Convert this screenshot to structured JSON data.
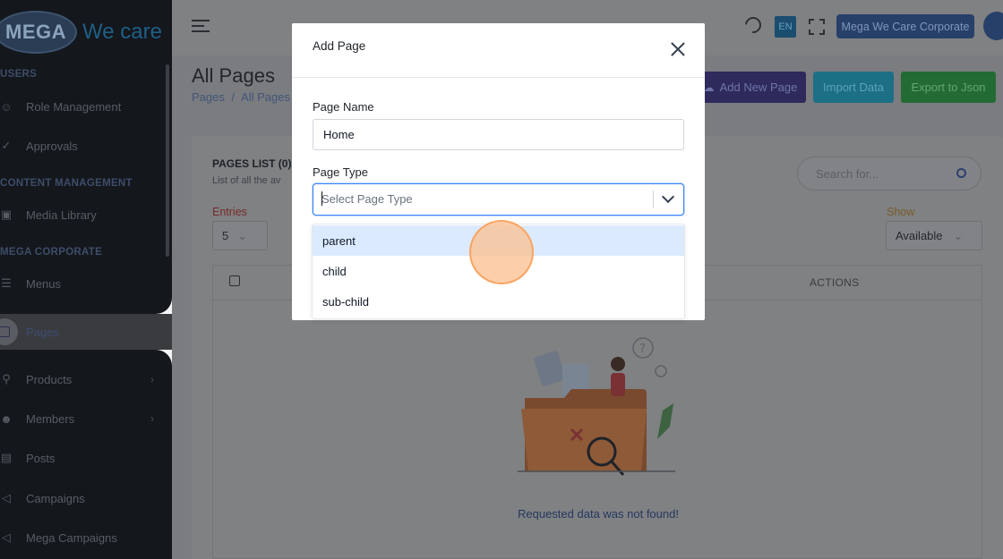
{
  "brand": {
    "logo_text": "MEGA",
    "logo_tagline": "We care"
  },
  "sidebar": {
    "sections": [
      {
        "title": "USERS"
      },
      {
        "title": "CONTENT MANAGEMENT"
      },
      {
        "title": "MEGA CORPORATE"
      }
    ],
    "items": [
      {
        "label": "Role Management",
        "icon": "user-icon"
      },
      {
        "label": "Approvals",
        "icon": "check-icon"
      },
      {
        "label": "Media Library",
        "icon": "image-icon"
      },
      {
        "label": "Menus",
        "icon": "menu-icon"
      },
      {
        "label": "Pages",
        "icon": "layout-icon",
        "active": true
      },
      {
        "label": "Products",
        "icon": "cart-icon",
        "has_children": true
      },
      {
        "label": "Members",
        "icon": "users-icon",
        "has_children": true
      },
      {
        "label": "Posts",
        "icon": "newspaper-icon"
      },
      {
        "label": "Campaigns",
        "icon": "megaphone-icon"
      },
      {
        "label": "Mega Campaigns",
        "icon": "megaphone-icon"
      }
    ]
  },
  "topbar": {
    "language": "EN",
    "account_label": "Mega We Care Corporate"
  },
  "page": {
    "title": "All Pages",
    "breadcrumb": [
      "Pages",
      "/",
      "All Pages"
    ],
    "buttons": {
      "add_new": "Add New Page",
      "import": "Import Data",
      "export": "Export to Json"
    }
  },
  "card": {
    "title": "PAGES LIST (0)",
    "subtitle": "List of all the av",
    "search_placeholder": "Search for...",
    "entries_label": "Entries",
    "entries_value": "5",
    "show_label": "Show",
    "show_value": "Available",
    "table_header_actions": "ACTIONS",
    "empty_message": "Requested data was not found!"
  },
  "modal": {
    "title": "Add Page",
    "page_name_label": "Page Name",
    "page_name_value": "Home",
    "page_type_label": "Page Type",
    "page_type_placeholder": "Select Page Type",
    "options": [
      "parent",
      "child",
      "sub-child"
    ],
    "focused_option": "parent"
  },
  "colors": {
    "accent_blue": "#3b82f6",
    "option_highlight": "#dbeafe",
    "add_button": "#2e2a5c",
    "import_button": "#1d6f86",
    "export_button": "#236b34"
  }
}
